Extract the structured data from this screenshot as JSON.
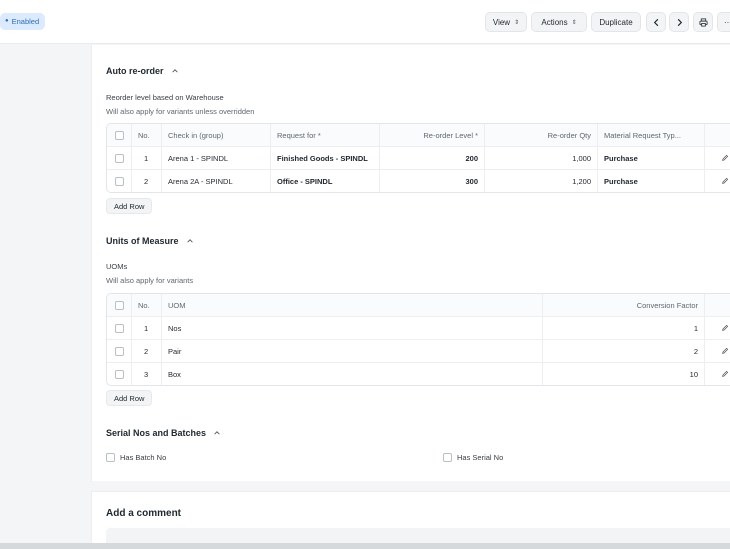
{
  "header": {
    "status_badge": "Enabled",
    "view_label": "View",
    "actions_label": "Actions",
    "duplicate_label": "Duplicate",
    "more_label": "···"
  },
  "reorder": {
    "title": "Auto re-order",
    "label": "Reorder level based on Warehouse",
    "hint": "Will also apply for variants unless overridden",
    "columns": [
      "No.",
      "Check in (group)",
      "Request for *",
      "Re-order Level *",
      "Re-order Qty",
      "Material Request Typ..."
    ],
    "rows": [
      {
        "no": "1",
        "check_in": "Arena 1 - SPINDL",
        "request_for": "Finished Goods - SPINDL",
        "level": "200",
        "qty": "1,000",
        "type": "Purchase"
      },
      {
        "no": "2",
        "check_in": "Arena 2A - SPINDL",
        "request_for": "Office - SPINDL",
        "level": "300",
        "qty": "1,200",
        "type": "Purchase"
      }
    ],
    "add_row": "Add Row"
  },
  "uom": {
    "title": "Units of Measure",
    "label": "UOMs",
    "hint": "Will also apply for variants",
    "columns": [
      "No.",
      "UOM",
      "Conversion Factor"
    ],
    "rows": [
      {
        "no": "1",
        "uom": "Nos",
        "factor": "1"
      },
      {
        "no": "2",
        "uom": "Pair",
        "factor": "2"
      },
      {
        "no": "3",
        "uom": "Box",
        "factor": "10"
      }
    ],
    "add_row": "Add Row"
  },
  "serial": {
    "title": "Serial Nos and Batches",
    "has_batch_no": "Has Batch No",
    "has_serial_no": "Has Serial No"
  },
  "comment": {
    "title": "Add a comment"
  }
}
